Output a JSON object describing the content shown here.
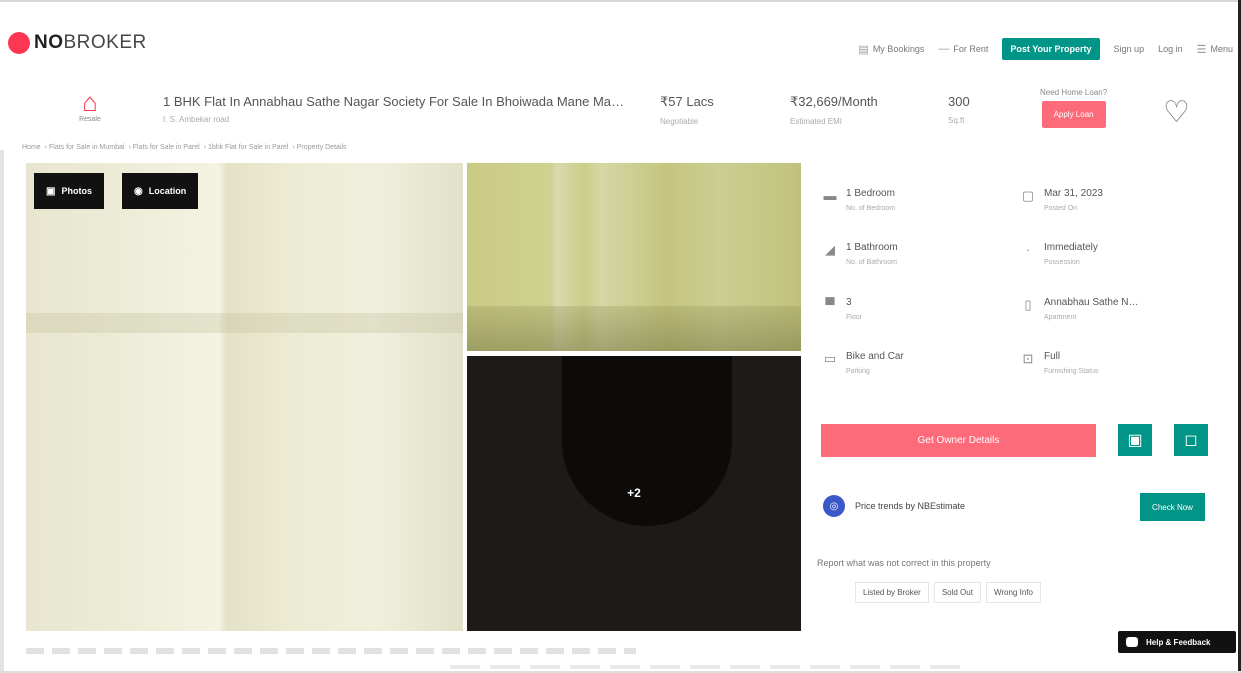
{
  "header": {
    "logo_bold": "NO",
    "logo_rest": "BROKER",
    "nav": {
      "bookings": "My Bookings",
      "for_rent": "For Rent",
      "post_property": "Post Your Property",
      "signup": "Sign up",
      "login": "Log in",
      "menu": "Menu"
    }
  },
  "listing": {
    "icon_label": "Resale",
    "title": "1 BHK Flat In Annabhau Sathe Nagar Society For Sale In Bhoiwada Mane Ma…",
    "subtitle": "I. S. Ambekar road",
    "price": "₹57 Lacs",
    "price_sub": "Negotiable",
    "emi": "₹32,669/Month",
    "emi_sub": "Estimated EMI",
    "area": "300",
    "area_sub": "Sq.ft",
    "loan_question": "Need Home Loan?",
    "loan_button": "Apply Loan"
  },
  "breadcrumb": [
    "Home",
    "Flats for Sale in Mumbai",
    "Flats for Sale in Parel",
    "1bhk Flat for Sale in Parel",
    "Property Details"
  ],
  "gallery": {
    "photos_label": "Photos",
    "location_label": "Location",
    "more_count": "+2"
  },
  "details": [
    {
      "value": "1 Bedroom",
      "sub": "No. of Bedroom",
      "icon": "bed-icon"
    },
    {
      "value": "Mar 31, 2023",
      "sub": "Posted On",
      "icon": "calendar-icon"
    },
    {
      "value": "1 Bathroom",
      "sub": "No. of Bathroom",
      "icon": "bath-icon"
    },
    {
      "value": "Immediately",
      "sub": "Possession",
      "icon": "key-icon"
    },
    {
      "value": "3",
      "sub": "Floor",
      "icon": "building-icon"
    },
    {
      "value": "Annabhau Sathe N…",
      "sub": "Apartment",
      "icon": "apartment-icon"
    },
    {
      "value": "Bike and Car",
      "sub": "Parking",
      "icon": "car-icon"
    },
    {
      "value": "Full",
      "sub": "Furnishing Status",
      "icon": "sofa-icon"
    }
  ],
  "actions": {
    "owner_button": "Get Owner Details",
    "trends_label": "Price trends by NBEstimate",
    "check_button": "Check Now",
    "report_text": "Report what was not correct in this property",
    "report_options": [
      "Listed by Broker",
      "Sold Out",
      "Wrong Info"
    ],
    "help_label": "Help & Feedback"
  },
  "colors": {
    "brand_red": "#fd3752",
    "button_pink": "#fd6a7a",
    "teal": "#009587"
  }
}
